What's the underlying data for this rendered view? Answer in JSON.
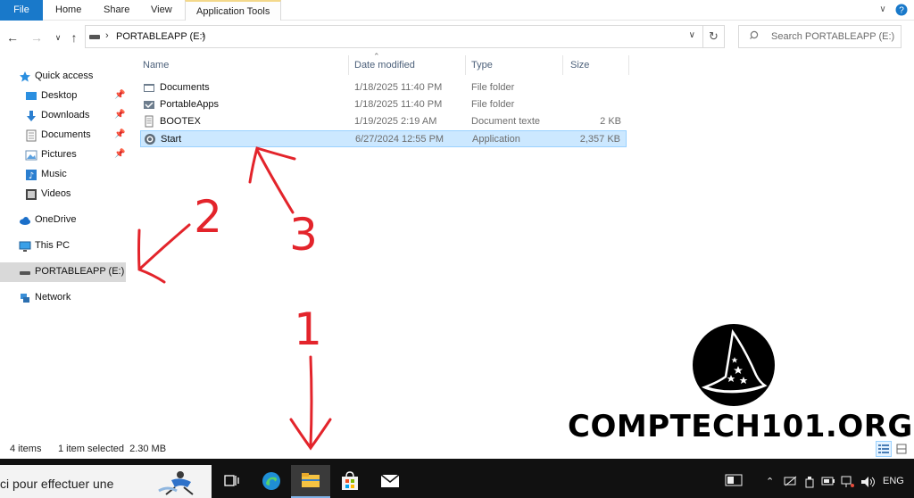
{
  "ribbon": {
    "tabs": [
      {
        "label": "File"
      },
      {
        "label": "Home"
      },
      {
        "label": "Share"
      },
      {
        "label": "View"
      },
      {
        "label": "Application Tools"
      }
    ]
  },
  "address": {
    "path": "PORTABLEAPP (E:)",
    "search_placeholder": "Search PORTABLEAPP (E:)"
  },
  "nav": {
    "items": [
      {
        "label": "Quick access",
        "icon": "star-icon"
      },
      {
        "label": "Desktop",
        "icon": "desktop-folder-icon",
        "pinned": true
      },
      {
        "label": "Downloads",
        "icon": "download-arrow-icon",
        "pinned": true
      },
      {
        "label": "Documents",
        "icon": "documents-folder-icon",
        "pinned": true
      },
      {
        "label": "Pictures",
        "icon": "pictures-folder-icon",
        "pinned": true
      },
      {
        "label": "Music",
        "icon": "music-note-icon"
      },
      {
        "label": "Videos",
        "icon": "video-icon"
      },
      {
        "label": "OneDrive",
        "icon": "cloud-icon"
      },
      {
        "label": "This PC",
        "icon": "monitor-icon"
      },
      {
        "label": "PORTABLEAPP (E:)",
        "icon": "drive-icon",
        "selected": true
      },
      {
        "label": "Network",
        "icon": "network-icon"
      }
    ]
  },
  "files": {
    "columns": [
      "Name",
      "Date modified",
      "Type",
      "Size"
    ],
    "rows": [
      {
        "name": "Documents",
        "date": "1/18/2025 11:40 PM",
        "type": "File folder",
        "size": "",
        "icon": "documents-folder-icon"
      },
      {
        "name": "PortableApps",
        "date": "1/18/2025 11:40 PM",
        "type": "File folder",
        "size": "",
        "icon": "portableapps-folder-icon"
      },
      {
        "name": "BOOTEX",
        "date": "1/19/2025 2:19 AM",
        "type": "Document texte",
        "size": "2 KB",
        "icon": "text-document-icon"
      },
      {
        "name": "Start",
        "date": "6/27/2024 12:55 PM",
        "type": "Application",
        "size": "2,357 KB",
        "icon": "portableapps-start-icon",
        "selected": true
      }
    ]
  },
  "status": {
    "item_count": "4 items",
    "selection": "1 item selected  2.30 MB"
  },
  "taskbar": {
    "search_text": "ci pour effectuer une",
    "language": "ENG"
  },
  "annotations": {
    "labels": [
      "1",
      "2",
      "3"
    ],
    "color": "#e3242b"
  },
  "watermark": {
    "text": "COMPTECH101.ORG"
  },
  "colors": {
    "file_tab": "#1979ca",
    "selection_bg": "#cce8ff",
    "selection_border": "#99d1ff",
    "nav_selected": "#d9d9d9"
  }
}
